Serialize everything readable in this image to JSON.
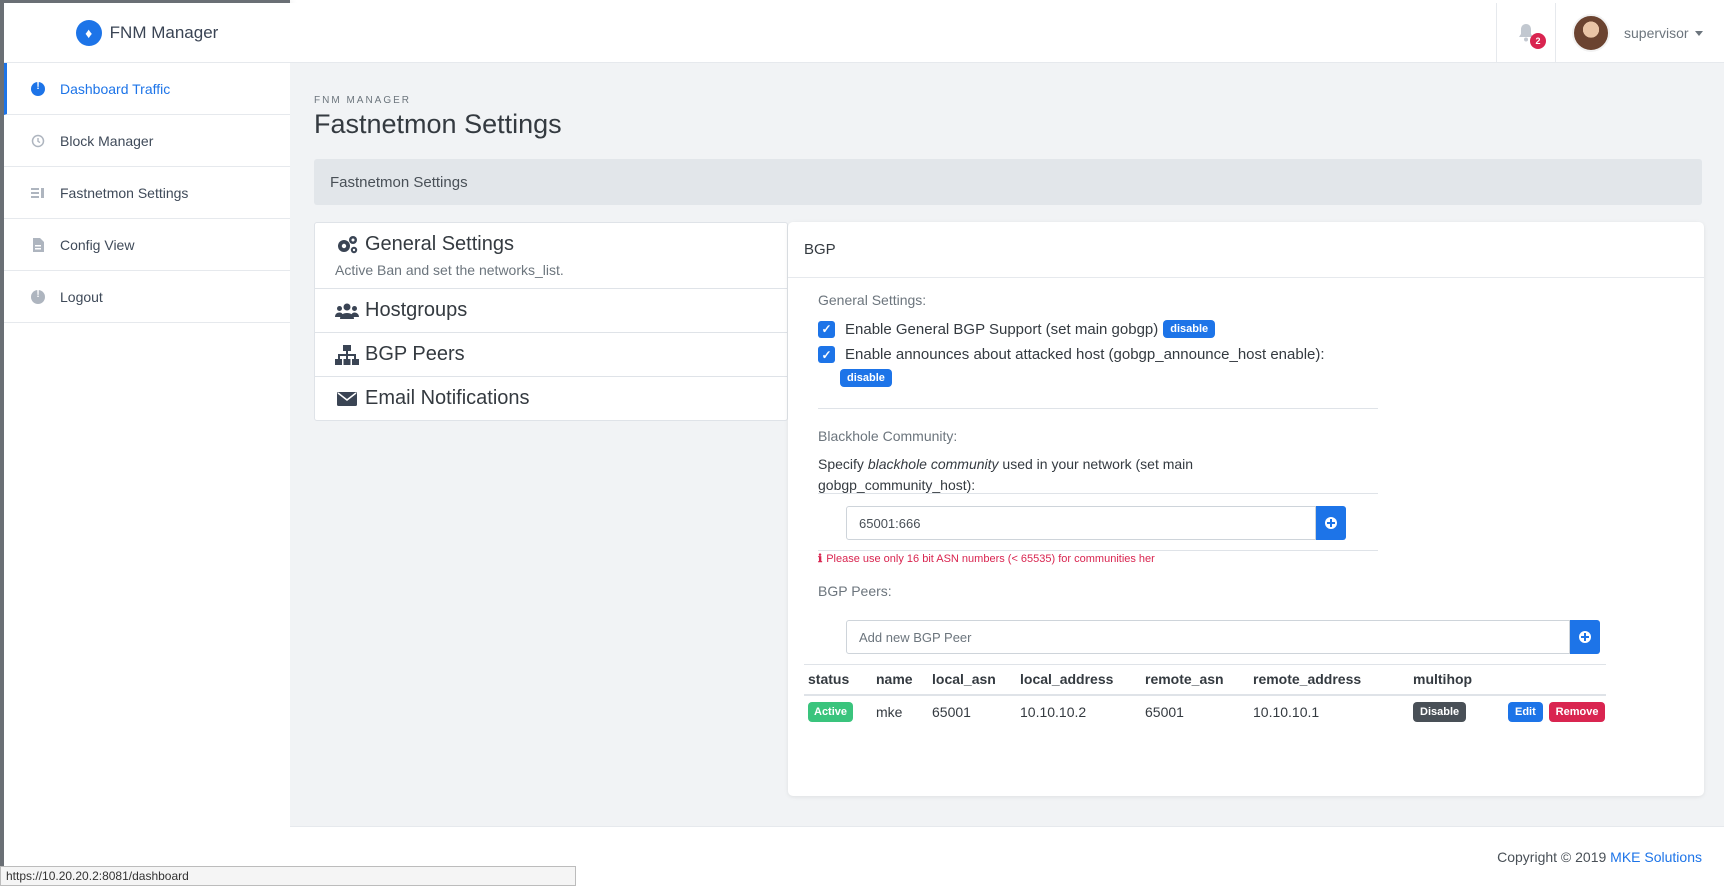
{
  "brand": {
    "name": "FNM Manager",
    "icon": "diamond-logo-icon"
  },
  "sidebar": {
    "items": [
      {
        "label": "Dashboard Traffic",
        "icon": "alert-circle-icon",
        "active": true
      },
      {
        "label": "Block Manager",
        "icon": "history-icon",
        "active": false
      },
      {
        "label": "Fastnetmon Settings",
        "icon": "list-icon",
        "active": false
      },
      {
        "label": "Config View",
        "icon": "file-icon",
        "active": false
      },
      {
        "label": "Logout",
        "icon": "alert-circle-icon",
        "active": false
      }
    ]
  },
  "header": {
    "notification_count": "2",
    "user_name": "supervisor"
  },
  "page": {
    "eyebrow": "FNM MANAGER",
    "title": "Fastnetmon Settings",
    "section_title": "Fastnetmon Settings"
  },
  "settings_menu": [
    {
      "title": "General Settings",
      "subtitle": "Active Ban and set the networks_list.",
      "icon": "cogs-icon"
    },
    {
      "title": "Hostgroups",
      "icon": "users-icon"
    },
    {
      "title": "BGP Peers",
      "icon": "sitemap-icon"
    },
    {
      "title": "Email Notifications",
      "icon": "envelope-icon"
    }
  ],
  "bgp": {
    "card_title": "BGP",
    "general_label": "General Settings:",
    "enable_bgp_label": "Enable General BGP Support (set main gobgp)",
    "enable_bgp_button": "disable",
    "enable_announce_label": "Enable announces about attacked host (gobgp_announce_host enable):",
    "enable_announce_button": "disable",
    "blackhole_label": "Blackhole Community:",
    "blackhole_desc_pre": "Specify ",
    "blackhole_desc_em": "blackhole community",
    "blackhole_desc_post": " used in your network (set main gobgp_community_host):",
    "community_value": "65001:666",
    "warning": "Please use only 16 bit ASN numbers (< 65535) for communities her",
    "peers_label": "BGP Peers:",
    "peer_placeholder": "Add new BGP Peer",
    "table": {
      "columns": [
        "status",
        "name",
        "local_asn",
        "local_address",
        "remote_asn",
        "remote_address",
        "multihop",
        ""
      ],
      "rows": [
        {
          "status": "Active",
          "name": "mke",
          "local_asn": "65001",
          "local_address": "10.10.10.2",
          "remote_asn": "65001",
          "remote_address": "10.10.10.1",
          "multihop": "Disable",
          "edit": "Edit",
          "remove": "Remove"
        }
      ]
    }
  },
  "footer": {
    "copyright": "Copyright © 2019 ",
    "company": "MKE Solutions"
  },
  "statusbar": {
    "url": "https://10.20.20.2:8081/dashboard"
  },
  "colors": {
    "primary": "#1d74e8",
    "success": "#3ac47d",
    "danger": "#d92550",
    "dark": "#495057"
  }
}
